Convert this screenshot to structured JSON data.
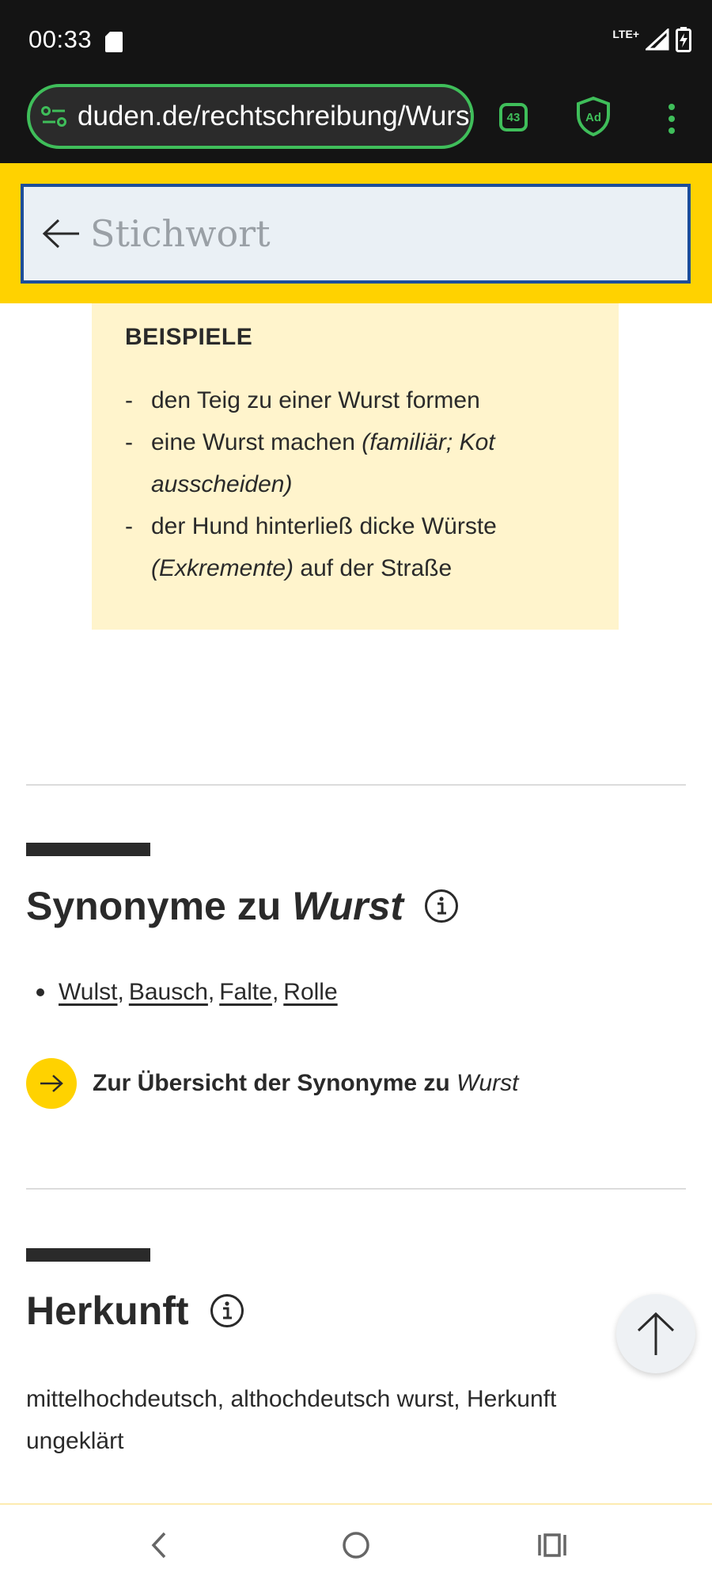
{
  "status_bar": {
    "time": "00:33",
    "network": "LTE+"
  },
  "browser": {
    "url": "duden.de/rechtschreibung/Wurst",
    "tab_count": "43",
    "ad_block_label": "Ad"
  },
  "search": {
    "placeholder": "Stichwort"
  },
  "beispiele": {
    "title": "BEISPIELE",
    "items": [
      {
        "text": "den Teig zu einer Wurst formen",
        "note": "",
        "after": ""
      },
      {
        "text": "eine Wurst machen ",
        "note": "(familiär; Kot ausscheiden)",
        "after": ""
      },
      {
        "text": "der Hund hinterließ dicke Würste ",
        "note": "(Exkremente)",
        "after": " auf der Straße"
      }
    ]
  },
  "synonyme": {
    "heading": "Synonyme zu",
    "heading_word": "Wurst",
    "links": [
      "Wulst",
      "Bausch",
      "Falte",
      "Rolle"
    ],
    "overview_text": "Zur Übersicht der Synonyme zu",
    "overview_word": "Wurst"
  },
  "herkunft": {
    "heading": "Herkunft",
    "text": "mittelhochdeutsch, althochdeutsch wurst, Herkunft ungeklärt"
  },
  "colors": {
    "duden_yellow": "#ffd200",
    "search_border": "#1d4e9a",
    "beispiele_bg": "#fff4cc",
    "browser_accent": "#3fbe5a"
  },
  "icons": {
    "status": [
      "sd-card-icon",
      "signal-icon",
      "battery-charging-icon"
    ],
    "browser": [
      "site-settings-icon",
      "tab-count-icon",
      "adblock-shield-icon",
      "menu-dots-icon"
    ],
    "page": [
      "back-arrow-icon",
      "info-icon",
      "arrow-right-icon",
      "scroll-top-icon"
    ],
    "nav": [
      "nav-back-icon",
      "nav-home-icon",
      "nav-recents-icon"
    ]
  }
}
